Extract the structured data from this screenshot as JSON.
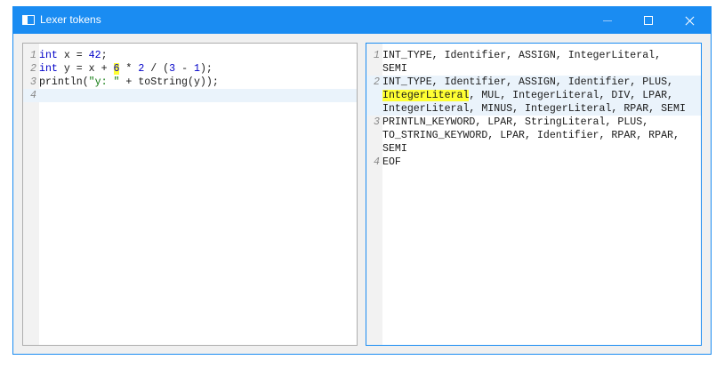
{
  "window": {
    "title": "Lexer tokens"
  },
  "source_editor": {
    "lines": [
      {
        "n": "1",
        "tokens": [
          {
            "t": "int",
            "c": "kw"
          },
          {
            "t": " x = ",
            "c": ""
          },
          {
            "t": "42",
            "c": "num"
          },
          {
            "t": ";",
            "c": ""
          }
        ]
      },
      {
        "n": "2",
        "tokens": [
          {
            "t": "int",
            "c": "kw"
          },
          {
            "t": " y = x + ",
            "c": ""
          },
          {
            "t": "6",
            "c": "num hl"
          },
          {
            "t": " * ",
            "c": ""
          },
          {
            "t": "2",
            "c": "num"
          },
          {
            "t": " / (",
            "c": ""
          },
          {
            "t": "3",
            "c": "num"
          },
          {
            "t": " - ",
            "c": ""
          },
          {
            "t": "1",
            "c": "num"
          },
          {
            "t": ");",
            "c": ""
          }
        ]
      },
      {
        "n": "3",
        "tokens": [
          {
            "t": "println(",
            "c": ""
          },
          {
            "t": "\"y: \"",
            "c": "str"
          },
          {
            "t": " + toString(y));",
            "c": ""
          }
        ]
      },
      {
        "n": "4",
        "current": true,
        "tokens": []
      }
    ]
  },
  "token_editor": {
    "lines": [
      {
        "n": "1",
        "visual": [
          [
            {
              "t": "INT_TYPE, Identifier, ASSIGN, IntegerLiteral,",
              "c": ""
            }
          ],
          [
            {
              "t": "SEMI",
              "c": ""
            }
          ]
        ]
      },
      {
        "n": "2",
        "current": true,
        "visual": [
          [
            {
              "t": "INT_TYPE, Identifier, ASSIGN, Identifier, PLUS,",
              "c": ""
            }
          ],
          [
            {
              "t": "IntegerLiteral",
              "c": "hl"
            },
            {
              "t": ", MUL, IntegerLiteral, DIV, LPAR,",
              "c": ""
            }
          ],
          [
            {
              "t": "IntegerLiteral, MINUS, IntegerLiteral, RPAR, SEMI",
              "c": ""
            }
          ]
        ]
      },
      {
        "n": "3",
        "visual": [
          [
            {
              "t": "PRINTLN_KEYWORD, LPAR, StringLiteral, PLUS,",
              "c": ""
            }
          ],
          [
            {
              "t": "TO_STRING_KEYWORD, LPAR, Identifier, RPAR, RPAR,",
              "c": ""
            }
          ],
          [
            {
              "t": "SEMI",
              "c": ""
            }
          ]
        ]
      },
      {
        "n": "4",
        "visual": [
          [
            {
              "t": "EOF",
              "c": ""
            }
          ]
        ]
      }
    ]
  },
  "colors": {
    "titlebar": "#1a8cf2",
    "keyword": "#0000c8",
    "string": "#107a10",
    "highlight": "#ffff33",
    "current_line": "#eaf3fb"
  },
  "icons": {
    "app": "window-icon",
    "minimize": "minimize-icon",
    "maximize": "maximize-icon",
    "close": "close-icon"
  }
}
